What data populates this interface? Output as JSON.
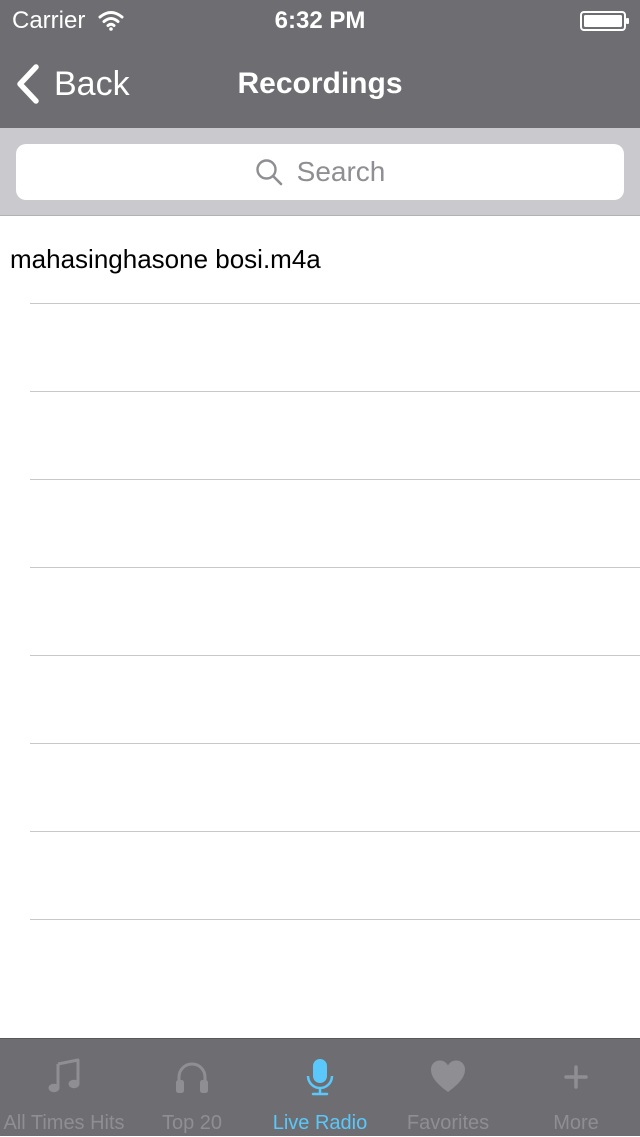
{
  "status_bar": {
    "carrier": "Carrier",
    "time": "6:32 PM"
  },
  "nav_bar": {
    "back_label": "Back",
    "title": "Recordings"
  },
  "search": {
    "placeholder": "Search"
  },
  "recordings": {
    "items": [
      {
        "name": "mahasinghasone bosi.m4a"
      },
      {
        "name": ""
      },
      {
        "name": ""
      },
      {
        "name": ""
      },
      {
        "name": ""
      },
      {
        "name": ""
      },
      {
        "name": ""
      },
      {
        "name": ""
      }
    ]
  },
  "tab_bar": {
    "active_index": 2,
    "active_color": "#5ac8fa",
    "inactive_color": "#8e8e93",
    "tabs": [
      {
        "label": "All Times Hits",
        "icon": "music-note-icon"
      },
      {
        "label": "Top 20",
        "icon": "headphones-icon"
      },
      {
        "label": "Live Radio",
        "icon": "microphone-icon"
      },
      {
        "label": "Favorites",
        "icon": "heart-icon"
      },
      {
        "label": "More",
        "icon": "plus-icon"
      }
    ]
  }
}
